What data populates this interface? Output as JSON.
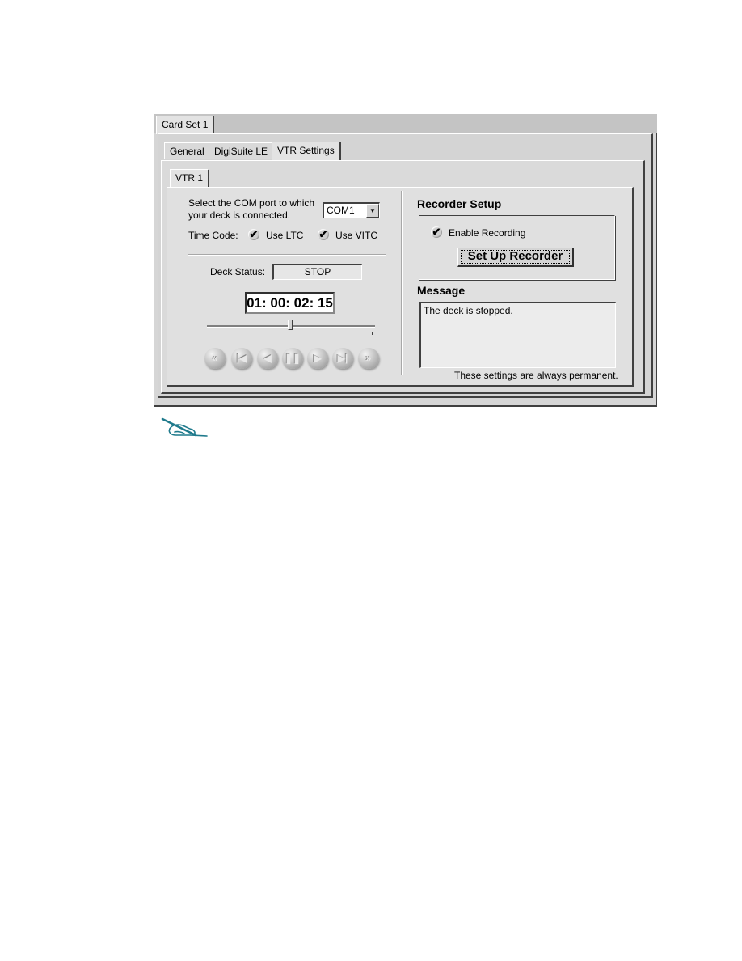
{
  "tabs_outer": [
    {
      "label": "Card Set 1",
      "active": true
    }
  ],
  "tabs_mid": [
    {
      "label": "General",
      "active": false
    },
    {
      "label": "DigiSuite LE",
      "active": false
    },
    {
      "label": "VTR Settings",
      "active": true
    }
  ],
  "tabs_inner": [
    {
      "label": "VTR 1",
      "active": true
    }
  ],
  "vtr": {
    "com_prompt_line1": "Select the COM port to which",
    "com_prompt_line2": "your deck is connected.",
    "com_port": "COM1",
    "dropdown_arrow": "▼",
    "timecode_label": "Time Code:",
    "use_ltc_label": "Use LTC",
    "use_ltc_checked": true,
    "use_vitc_label": "Use VITC",
    "use_vitc_checked": true,
    "check_glyph": "✔",
    "deck_status_label": "Deck Status:",
    "deck_status": "STOP",
    "timecode": "01: 00: 02: 15",
    "slider_position": 0.5,
    "transport": [
      {
        "name": "rewind",
        "glyph": "«"
      },
      {
        "name": "go-to-start",
        "glyph": "|◀"
      },
      {
        "name": "play-reverse",
        "glyph": "◀"
      },
      {
        "name": "pause",
        "glyph": "❚❚"
      },
      {
        "name": "play",
        "glyph": "▶"
      },
      {
        "name": "go-to-end",
        "glyph": "▶|"
      },
      {
        "name": "fast-forward",
        "glyph": "»"
      }
    ]
  },
  "recorder": {
    "heading": "Recorder Setup",
    "enable_label": "Enable Recording",
    "enable_checked": true,
    "setup_button": "Set Up Recorder"
  },
  "message": {
    "heading": "Message",
    "text": "The deck is stopped.",
    "footnote": "These settings are always permanent."
  },
  "note_icon": "note-hand-icon",
  "colors": {
    "note_icon": "#1f7a8c"
  }
}
